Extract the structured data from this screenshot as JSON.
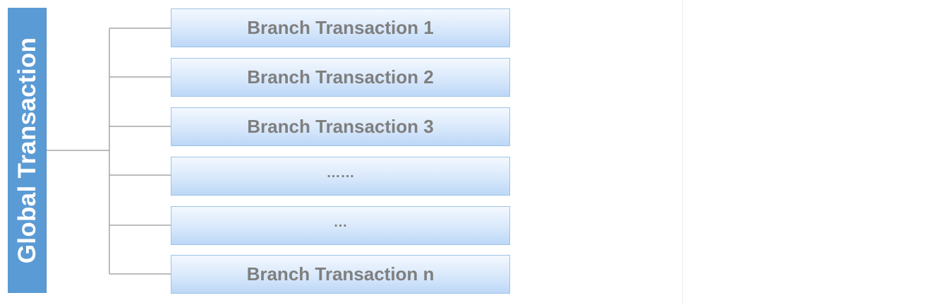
{
  "diagram": {
    "root": {
      "label": "Global Transaction"
    },
    "branches": [
      {
        "label": "Branch Transaction 1"
      },
      {
        "label": "Branch Transaction 2"
      },
      {
        "label": "Branch Transaction 3"
      },
      {
        "label": "……"
      },
      {
        "label": "…"
      },
      {
        "label": "Branch Transaction n"
      }
    ],
    "colors": {
      "root_fill": "#5b9bd5",
      "root_text": "#ffffff",
      "branch_border": "#9dc3e6",
      "branch_fill_top": "#f3f8fe",
      "branch_fill_bottom": "#bcd7f7",
      "branch_text": "#7f7f7f",
      "connector": "#a6a6a6"
    }
  }
}
